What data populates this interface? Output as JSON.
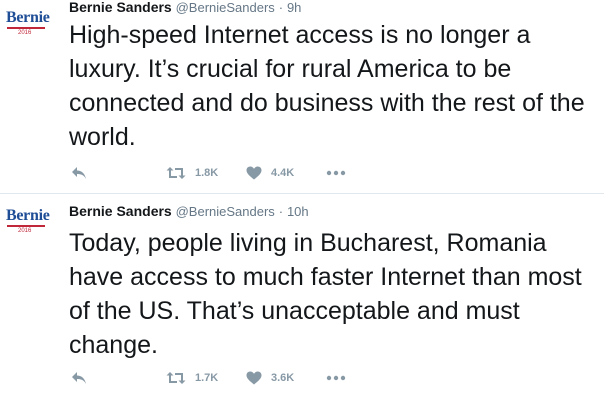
{
  "tweets": [
    {
      "avatar_text": "Bernie",
      "avatar_year": "2016",
      "name": "Bernie Sanders",
      "handle": "@BernieSanders",
      "separator": "·",
      "time": "9h",
      "text": "High-speed Internet access is no longer a luxury. It’s crucial for rural America to be connected and do business with the rest of the world.",
      "retweets": "1.8K",
      "likes": "4.4K"
    },
    {
      "avatar_text": "Bernie",
      "avatar_year": "2016",
      "name": "Bernie Sanders",
      "handle": "@BernieSanders",
      "separator": "·",
      "time": "10h",
      "text": "Today, people living in Bucharest, Romania have access to much faster Internet than most of the US. That’s unacceptable and must change.",
      "retweets": "1.7K",
      "likes": "3.6K"
    }
  ],
  "colors": {
    "icon": "#8899a6",
    "avatar_blue": "#1f4e96",
    "avatar_red": "#c0283a",
    "divider": "#e1e8ed"
  },
  "icons": [
    "reply-icon",
    "retweet-icon",
    "heart-icon",
    "more-icon"
  ]
}
